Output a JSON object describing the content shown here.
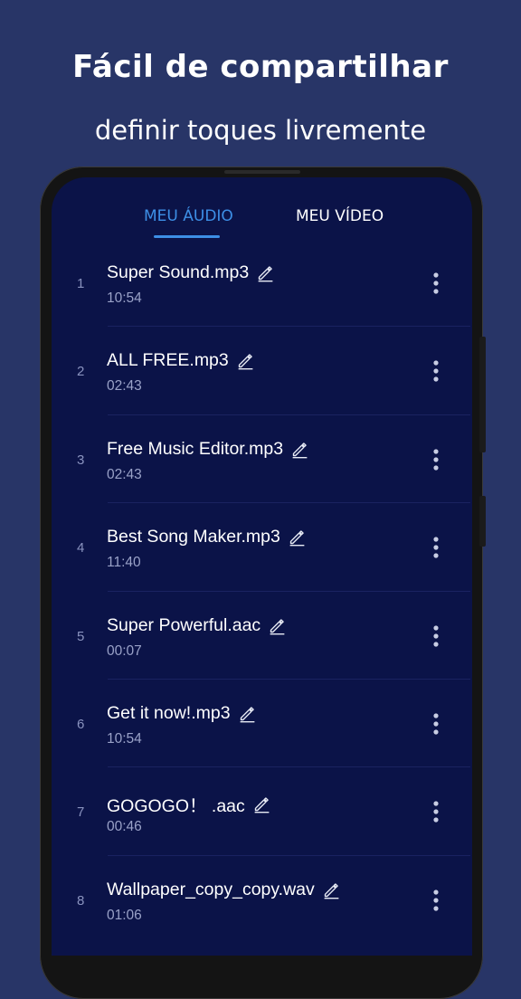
{
  "header": {
    "title": "Fácil de compartilhar",
    "subtitle": "definir toques livremente"
  },
  "tabs": [
    {
      "label": "MEU ÁUDIO",
      "active": true
    },
    {
      "label": "MEU VÍDEO",
      "active": false
    }
  ],
  "colors": {
    "background": "#283567",
    "screen": "#0b1348",
    "accent": "#3d8fe6"
  },
  "list": {
    "items": [
      {
        "index": "1",
        "name": "Super Sound.mp3",
        "duration": "10:54"
      },
      {
        "index": "2",
        "name": "ALL FREE.mp3",
        "duration": "02:43"
      },
      {
        "index": "3",
        "name": "Free Music Editor.mp3",
        "duration": "02:43"
      },
      {
        "index": "4",
        "name": "Best Song Maker.mp3",
        "duration": "11:40"
      },
      {
        "index": "5",
        "name": "Super Powerful.aac",
        "duration": "00:07"
      },
      {
        "index": "6",
        "name": "Get it now!.mp3",
        "duration": "10:54"
      },
      {
        "index": "7",
        "name": "GOGOGO！ .aac",
        "duration": "00:46"
      },
      {
        "index": "8",
        "name": "Wallpaper_copy_copy.wav",
        "duration": "01:06"
      }
    ],
    "item_icons": {
      "edit": "pencil-edit-icon",
      "more": "more-vertical-icon"
    }
  }
}
